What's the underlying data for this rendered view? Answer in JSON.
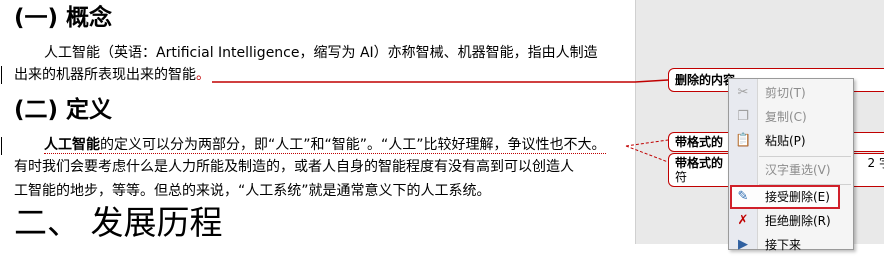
{
  "document": {
    "heading_1": "(一) 概念",
    "para_1_line_1": "人工智能（英语：Artificial Intelligence，缩写为 AI）亦称智械、机器智能，指由人制造",
    "para_1_line_2": "出来的机器所表现出来的智能",
    "para_1_line_2_end": "。",
    "heading_2": "(二) 定义",
    "para_2_line_1_bold": "人工智能",
    "para_2_line_1_rest": "的定义可以分为两部分，即“人工”和“智能”。“人工”比较好理解，争议性也不大。",
    "para_2_line_2": "有时我们会要考虑什么是人力所能及制造的，或者人自身的智能程度有没有高到可以创造人",
    "para_2_line_3": "工智能的地步，等等。但总的来说，“人工系统”就是通常意义下的人工系统。",
    "heading_3": "二、  发展历程"
  },
  "markup": {
    "balloon_delete": "删除的内容",
    "balloon_format_1": "带格式的",
    "balloon_format_2_line_1": "带格式的",
    "balloon_format_2_extra": "2 字",
    "balloon_format_2_line_2": "符"
  },
  "context_menu": {
    "items": [
      {
        "label": "剪切(T)",
        "icon": "scissors-icon",
        "enabled": false
      },
      {
        "label": "复制(C)",
        "icon": "copy-icon",
        "enabled": false
      },
      {
        "label": "粘贴(P)",
        "icon": "paste-icon",
        "enabled": true
      },
      {
        "label": "汉字重选(V)",
        "icon": "",
        "enabled": false
      },
      {
        "label": "接受删除(E)",
        "icon": "accept-change-icon",
        "enabled": true,
        "highlighted": true
      },
      {
        "label": "拒绝删除(R)",
        "icon": "reject-change-icon",
        "enabled": true
      },
      {
        "label": "接下来",
        "icon": "next-icon",
        "enabled": true
      }
    ]
  },
  "colors": {
    "revision_red": "#c00000",
    "markup_pane": "#e9e9e9",
    "menu_bg": "#f5f5f5",
    "highlight_box": "#d0202a"
  }
}
